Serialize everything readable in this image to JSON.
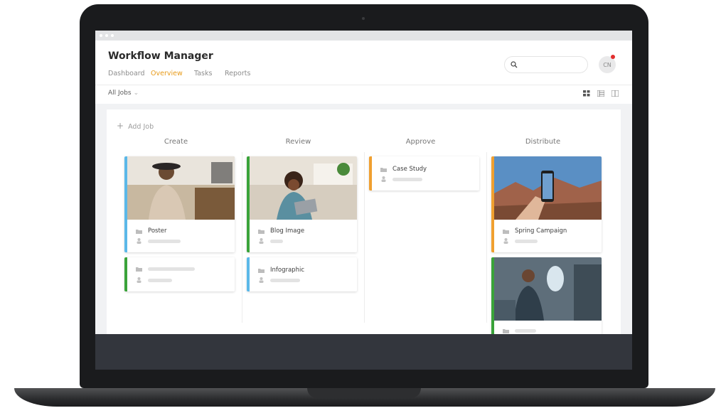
{
  "app": {
    "title": "Workflow Manager",
    "nav": [
      "Dashboard",
      "Overview",
      "Tasks",
      "Reports"
    ],
    "active_nav": "Overview",
    "avatar_initials": "CN",
    "filter_label": "All Jobs",
    "add_job_label": "Add Job",
    "accent_color": "#e89b1a"
  },
  "board": {
    "columns": [
      {
        "name": "Create",
        "cards": [
          {
            "title": "Poster",
            "has_image": true,
            "status_color": "#5bb8e8"
          },
          {
            "title": "",
            "has_image": false,
            "status_color": "#3aa33a"
          }
        ]
      },
      {
        "name": "Review",
        "cards": [
          {
            "title": "Blog Image",
            "has_image": true,
            "status_color": "#3aa33a"
          },
          {
            "title": "Infographic",
            "has_image": false,
            "status_color": "#5bb8e8"
          }
        ]
      },
      {
        "name": "Approve",
        "cards": [
          {
            "title": "Case Study",
            "has_image": false,
            "status_color": "#f0a030"
          }
        ]
      },
      {
        "name": "Distribute",
        "cards": [
          {
            "title": "Spring Campaign",
            "has_image": true,
            "status_color": "#f0a030"
          },
          {
            "title": "",
            "has_image": true,
            "status_color": "#3aa33a"
          }
        ]
      }
    ]
  },
  "icons": {
    "search": "search-icon",
    "folder": "folder-icon",
    "user": "user-icon",
    "add": "plus-icon",
    "views": [
      "grid-view-icon",
      "list-view-icon",
      "column-view-icon"
    ]
  }
}
